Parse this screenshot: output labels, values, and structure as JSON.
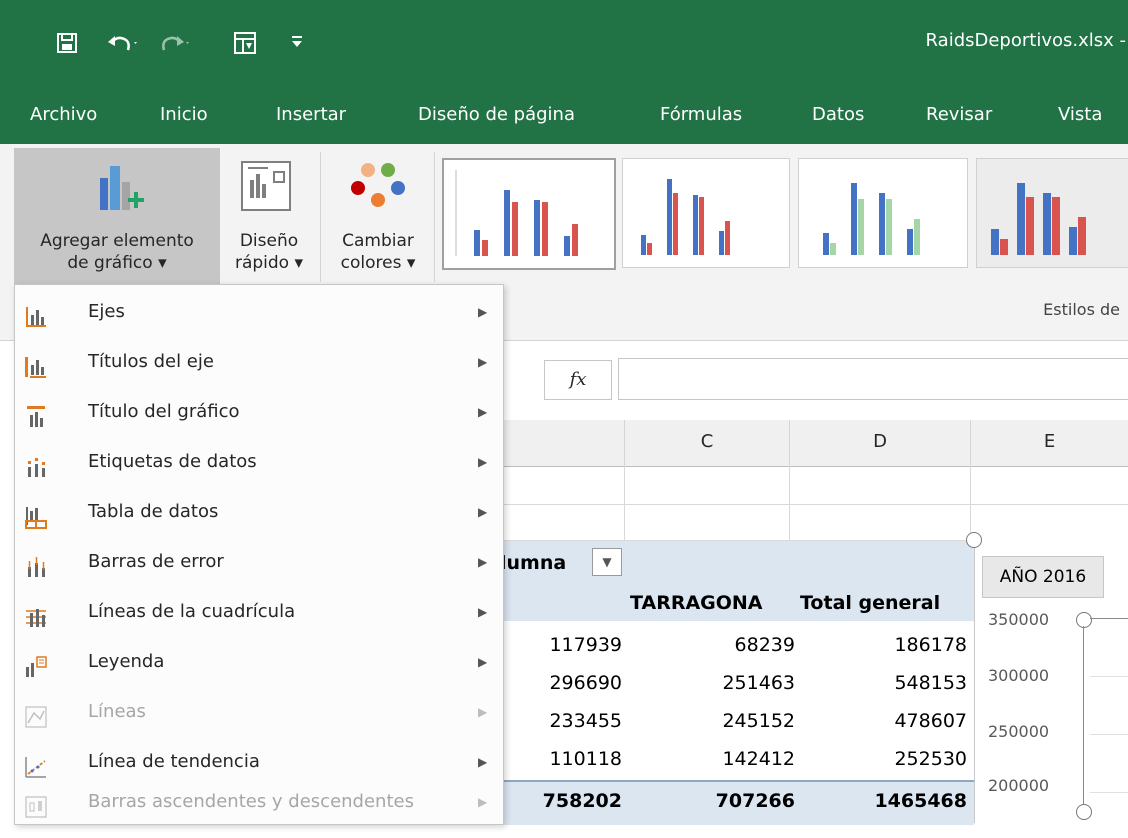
{
  "window": {
    "filename": "RaidsDeportivos.xlsx -"
  },
  "qat": {
    "save_icon": "save-icon",
    "undo_icon": "undo-icon",
    "redo_icon": "redo-icon",
    "form_icon": "form-icon",
    "customize_icon": "customize-qat-icon"
  },
  "ribbon_tabs": [
    "Archivo",
    "Inicio",
    "Insertar",
    "Diseño de página",
    "Fórmulas",
    "Datos",
    "Revisar",
    "Vista"
  ],
  "ribbon": {
    "add_element": {
      "line1": "Agregar elemento",
      "line2": "de gráfico ▾"
    },
    "quick_layout": {
      "line1": "Diseño",
      "line2": "rápido ▾"
    },
    "change_colors": {
      "line1": "Cambiar",
      "line2": "colores ▾"
    },
    "styles_group_label": "Estilos de"
  },
  "formula_bar": {
    "fx_label": "fx",
    "value": ""
  },
  "columns": [
    "C",
    "D",
    "E"
  ],
  "pivot": {
    "column_label": "lumna",
    "header_tarragona": "TARRAGONA",
    "header_total": "Total general",
    "rows": [
      {
        "c": "117939",
        "d": "68239",
        "e": "186178"
      },
      {
        "c": "296690",
        "d": "251463",
        "e": "548153"
      },
      {
        "c": "233455",
        "d": "245152",
        "e": "478607"
      },
      {
        "c": "110118",
        "d": "142412",
        "e": "252530"
      }
    ],
    "totals": {
      "c": "758202",
      "d": "707266",
      "e": "1465468"
    }
  },
  "chart": {
    "year_button": "AÑO 2016",
    "y_ticks": [
      "350000",
      "300000",
      "250000",
      "200000"
    ]
  },
  "menu": {
    "items": [
      {
        "label": "Ejes",
        "icon": "axes-icon",
        "enabled": true
      },
      {
        "label": "Títulos del eje",
        "icon": "axis-titles-icon",
        "enabled": true
      },
      {
        "label": "Título del gráfico",
        "icon": "chart-title-icon",
        "enabled": true
      },
      {
        "label": "Etiquetas de datos",
        "icon": "data-labels-icon",
        "enabled": true
      },
      {
        "label": "Tabla de datos",
        "icon": "data-table-icon",
        "enabled": true
      },
      {
        "label": "Barras de error",
        "icon": "error-bars-icon",
        "enabled": true
      },
      {
        "label": "Líneas de la cuadrícula",
        "icon": "gridlines-icon",
        "enabled": true
      },
      {
        "label": "Leyenda",
        "icon": "legend-icon",
        "enabled": true
      },
      {
        "label": "Líneas",
        "icon": "lines-icon",
        "enabled": false
      },
      {
        "label": "Línea de tendencia",
        "icon": "trendline-icon",
        "enabled": true
      },
      {
        "label": "Barras ascendentes y descendentes",
        "icon": "up-down-bars-icon",
        "enabled": false
      }
    ]
  },
  "colors": {
    "excel_green": "#217346",
    "accent_orange": "#e07a1f",
    "bar_blue": "#4472c4",
    "bar_red": "#d9534f"
  }
}
